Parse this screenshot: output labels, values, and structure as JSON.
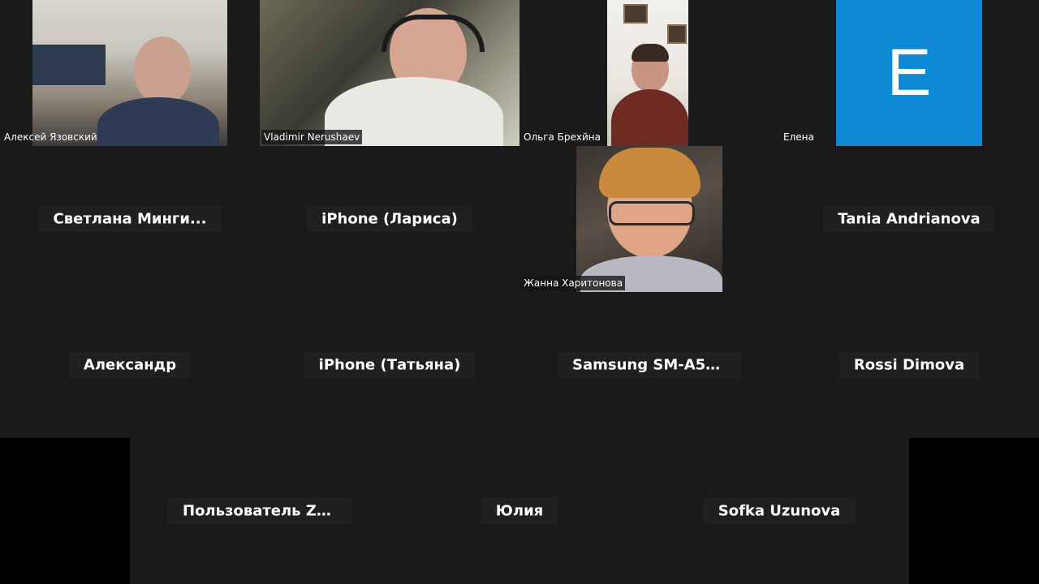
{
  "participants_row1": [
    {
      "name": "Алексей Язовский"
    },
    {
      "name": "Vladimir Nerushaev"
    },
    {
      "name": "Ольга Брехйна"
    },
    {
      "name": "Елена",
      "avatar_letter": "E",
      "avatar_color": "#0e8ad4"
    }
  ],
  "participants_row2": [
    {
      "name": "Светлана  Минги..."
    },
    {
      "name": "iPhone (Лариса)"
    },
    {
      "name": "Жанна Харитонова"
    },
    {
      "name": "Tania Andrianova"
    }
  ],
  "participants_row3": [
    {
      "name": "Александр"
    },
    {
      "name": "iPhone (Татьяна)"
    },
    {
      "name": "Samsung  SM-A54..."
    },
    {
      "name": "Rossi Dimova"
    }
  ],
  "participants_row4": [
    {
      "name": "Пользователь  Zo..."
    },
    {
      "name": "Юлия"
    },
    {
      "name": "Sofka Uzunova"
    }
  ],
  "colors": {
    "background": "#1a1a1a",
    "tile_label_bg": "#202020",
    "side_bars": "#000000"
  }
}
